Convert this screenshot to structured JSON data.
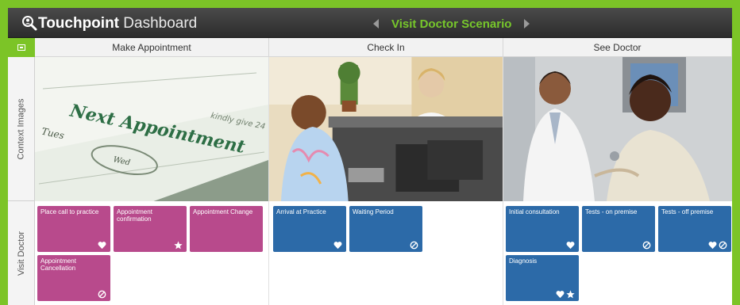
{
  "header": {
    "app_title_bold": "Touchpoint",
    "app_title_light": "Dashboard",
    "scenario_title": "Visit Doctor Scenario",
    "icons": [
      "magnifier-person-icon",
      "arrow-left-icon",
      "arrow-right-icon"
    ]
  },
  "rows": {
    "context_label": "Context Images",
    "visit_label": "Visit Doctor"
  },
  "stages": [
    {
      "name": "Make Appointment",
      "photo_text": [
        "Next Appointment",
        "Tues",
        "Wed",
        "kindly give 24"
      ],
      "tiles": [
        {
          "label": "Place call to practice",
          "color": "pink",
          "icons": [
            "heart"
          ]
        },
        {
          "label": "Appointment confirmation",
          "color": "pink",
          "icons": [
            "star"
          ]
        },
        {
          "label": "Appointment Change",
          "color": "pink",
          "icons": []
        },
        {
          "label": "Appointment Cancellation",
          "color": "pink",
          "icons": [
            "no"
          ]
        }
      ]
    },
    {
      "name": "Check In",
      "tiles": [
        {
          "label": "Arrival at Practice",
          "color": "blue",
          "icons": [
            "heart"
          ]
        },
        {
          "label": "Waiting Period",
          "color": "blue",
          "icons": [
            "no"
          ]
        }
      ]
    },
    {
      "name": "See Doctor",
      "tiles": [
        {
          "label": "Initial consultation",
          "color": "blue",
          "icons": [
            "heart"
          ]
        },
        {
          "label": "Tests - on premise",
          "color": "blue",
          "icons": [
            "no"
          ]
        },
        {
          "label": "Tests - off premise",
          "color": "blue",
          "icons": [
            "heart",
            "no"
          ]
        },
        {
          "label": "Diagnosis",
          "color": "blue",
          "icons": [
            "heart",
            "star"
          ]
        }
      ]
    }
  ],
  "colors": {
    "accent_green": "#7cc427",
    "tile_pink": "#b84a8c",
    "tile_blue": "#2c6aa8"
  }
}
